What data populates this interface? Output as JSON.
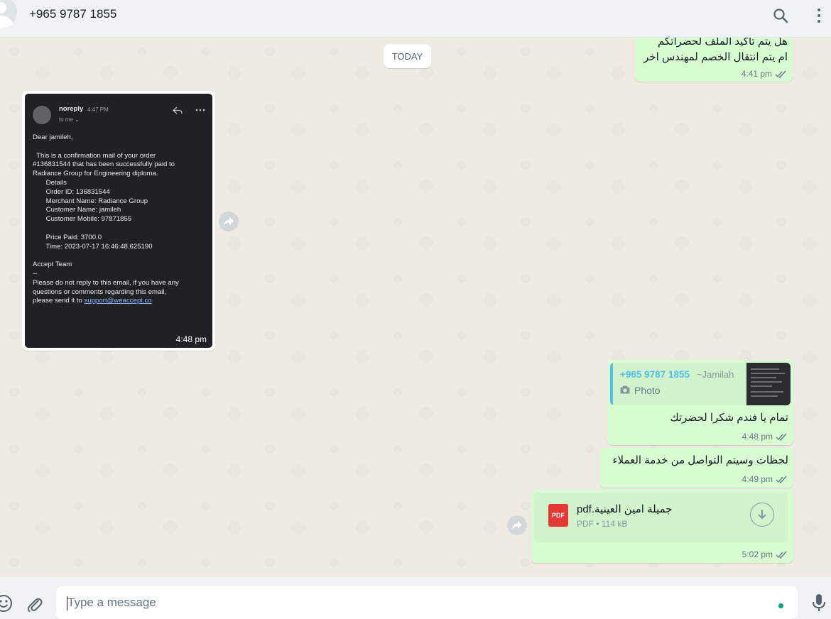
{
  "header": {
    "contact_name": "+965 9787 1855"
  },
  "chat": {
    "date_chip": "TODAY",
    "messages": [
      {
        "direction": "out",
        "lines": [
          "هل يتم تأكيد الملف لحضراتكم",
          "ام يتم انتقال الخصم لمهندس اخر"
        ],
        "time": "4:41 pm"
      },
      {
        "direction": "in",
        "type": "image",
        "time": "4:48 pm",
        "email": {
          "sender": "noreply",
          "sent_time": "4:47 PM",
          "to": "to me ⌄",
          "body": "Dear jamileh,\n\n  This is a confirmation mail of your order\n#136831544 that has been successfully paid to\nRadiance Group for Engineering diploma.\n       Details\n       Order ID: 136831544\n       Merchant Name: Radiance Group\n       Customer Name: jamileh\n       Customer Mobile: 97871855\n\n       Price Paid: 3700.0\n       Time: 2023-07-17 16:46:48.625190\n\nAccept Team\n--\nPlease do not reply to this email, if you have any\nquestions or comments regarding this email,\nplease send it to ",
          "link": "support@weaccept.co"
        }
      },
      {
        "direction": "out",
        "quote": {
          "number": "+965 9787 1855",
          "alias": "~Jamilah",
          "type": "Photo"
        },
        "text": "تمام يا فندم شكرا لحضرتك",
        "time": "4:48 pm"
      },
      {
        "direction": "out",
        "text": "لحظات وسيتم التواصل من خدمة العملاء",
        "time": "4:49 pm"
      },
      {
        "direction": "out",
        "type": "document",
        "doc": {
          "badge": "PDF",
          "name": "جميلة امين العينية.pdf",
          "info": "PDF • 114 kB"
        },
        "time": "5:02 pm"
      }
    ]
  },
  "footer": {
    "placeholder": "Type a message"
  },
  "colors": {
    "outgoing_bubble": "#d9fdd3",
    "incoming_bubble": "#ffffff",
    "chat_background": "#efeae2",
    "read_ticks": "#667781",
    "accent": "#00a884",
    "quote_name": "#53bdeb",
    "pdf_red": "#e53935"
  },
  "icons": [
    "avatar",
    "search-icon",
    "menu-icon",
    "forward-icon",
    "ticks-icon",
    "camera-icon",
    "pdf-icon",
    "download-icon",
    "emoji-icon",
    "attach-icon",
    "mic-icon",
    "reply-icon",
    "more-icon"
  ]
}
